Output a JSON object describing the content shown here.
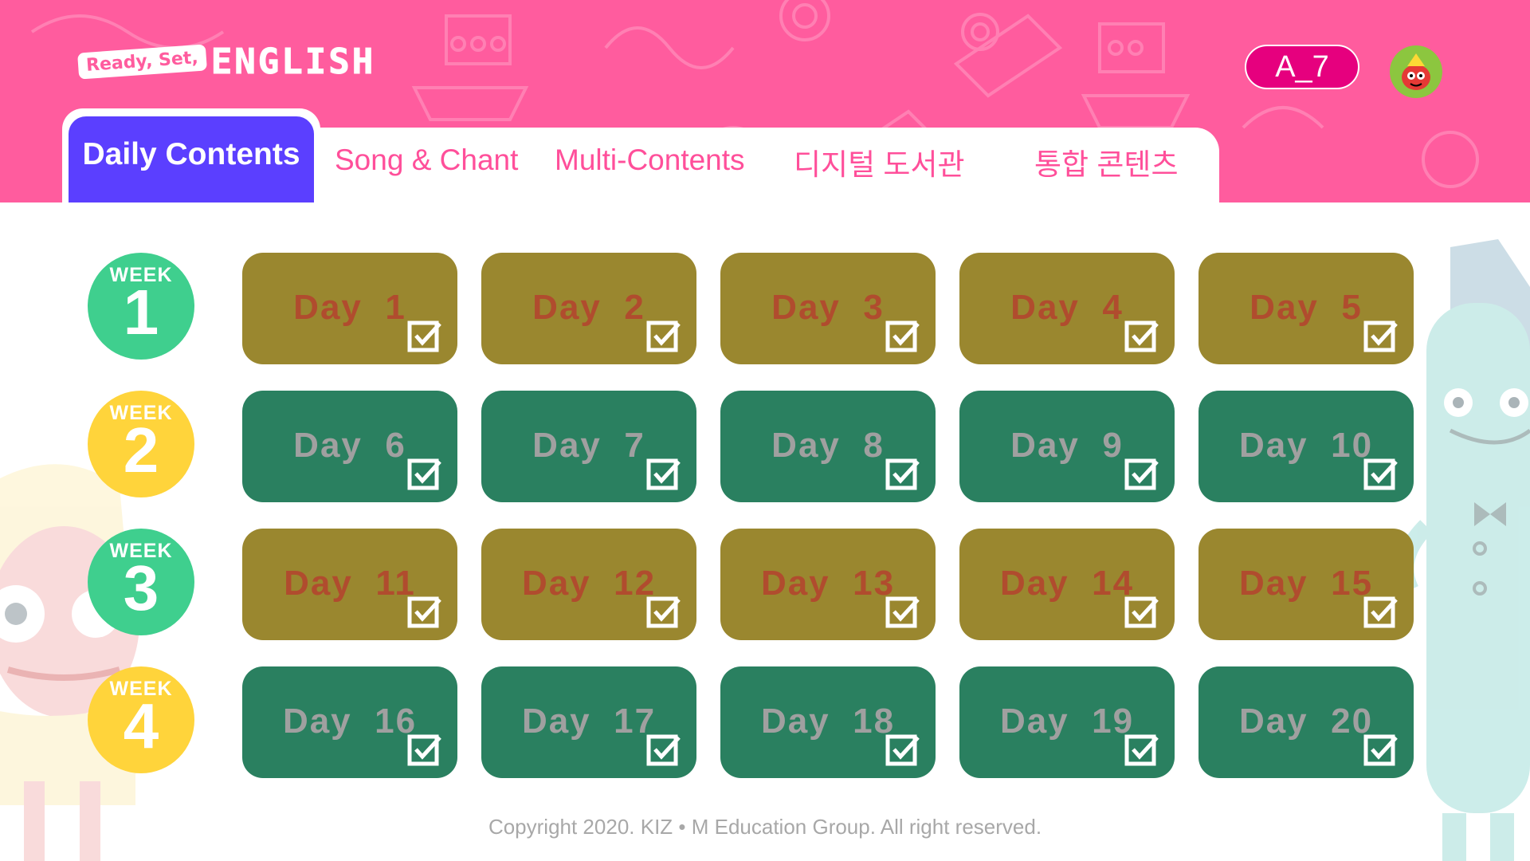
{
  "header": {
    "logo_ready": "Ready, Set,",
    "logo_english": "ENGLISH",
    "class_code": "A_7",
    "brand_color": "#ff5c9e"
  },
  "tabs": [
    {
      "label": "Daily Contents",
      "active": true
    },
    {
      "label": "Song & Chant",
      "active": false
    },
    {
      "label": "Multi-Contents",
      "active": false
    },
    {
      "label": "디지털 도서관",
      "active": false
    },
    {
      "label": "통합 콘텐츠",
      "active": false
    }
  ],
  "weeks": [
    {
      "label": "WEEK",
      "number": "1"
    },
    {
      "label": "WEEK",
      "number": "2"
    },
    {
      "label": "WEEK",
      "number": "3"
    },
    {
      "label": "WEEK",
      "number": "4"
    }
  ],
  "days": [
    [
      "Day  1",
      "Day  2",
      "Day  3",
      "Day  4",
      "Day  5"
    ],
    [
      "Day  6",
      "Day  7",
      "Day  8",
      "Day  9",
      "Day  10"
    ],
    [
      "Day  11",
      "Day  12",
      "Day  13",
      "Day  14",
      "Day  15"
    ],
    [
      "Day  16",
      "Day  17",
      "Day  18",
      "Day  19",
      "Day  20"
    ]
  ],
  "colors": {
    "active_tab": "#5b3fff",
    "tab_text": "#ff4f9a",
    "day_olive": "#9a872f",
    "day_green": "#2a8060",
    "week_green": "#3fcf8e",
    "week_yellow": "#ffd43b"
  },
  "footer": {
    "copyright": "Copyright 2020. KIZ • M Education Group. All right reserved."
  }
}
